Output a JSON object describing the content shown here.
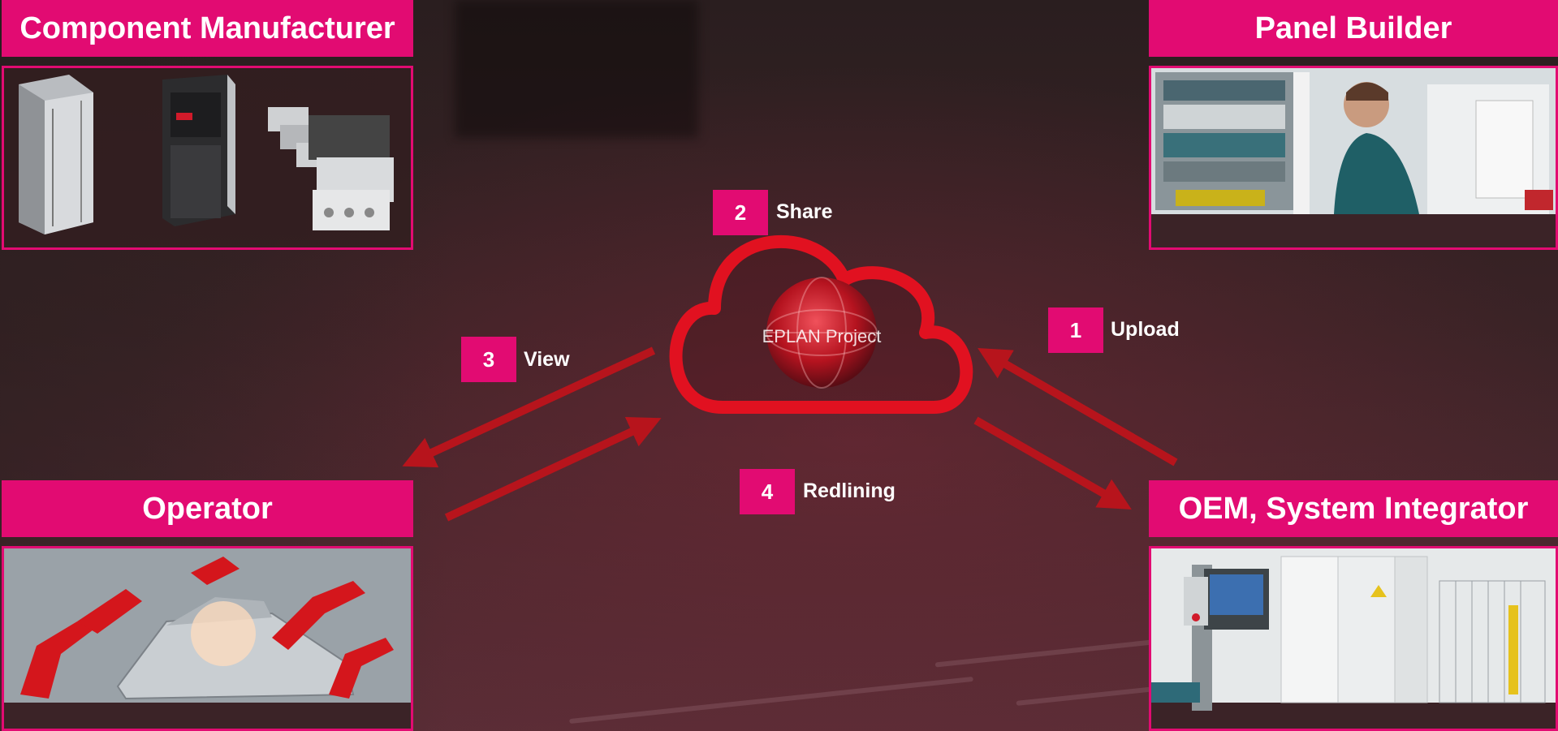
{
  "cards": {
    "component_manufacturer": {
      "title": "Component Manufacturer"
    },
    "panel_builder": {
      "title": "Panel Builder"
    },
    "operator": {
      "title": "Operator"
    },
    "oem": {
      "title": "OEM, System Integrator"
    }
  },
  "cloud": {
    "caption": "EPLAN Project"
  },
  "steps": [
    {
      "number": "1",
      "label": "Upload"
    },
    {
      "number": "2",
      "label": "Share"
    },
    {
      "number": "3",
      "label": "View"
    },
    {
      "number": "4",
      "label": "Redlining"
    }
  ],
  "colors": {
    "accent": "#e20b72",
    "arrow": "#b7141c",
    "cloud": "#e11120"
  }
}
